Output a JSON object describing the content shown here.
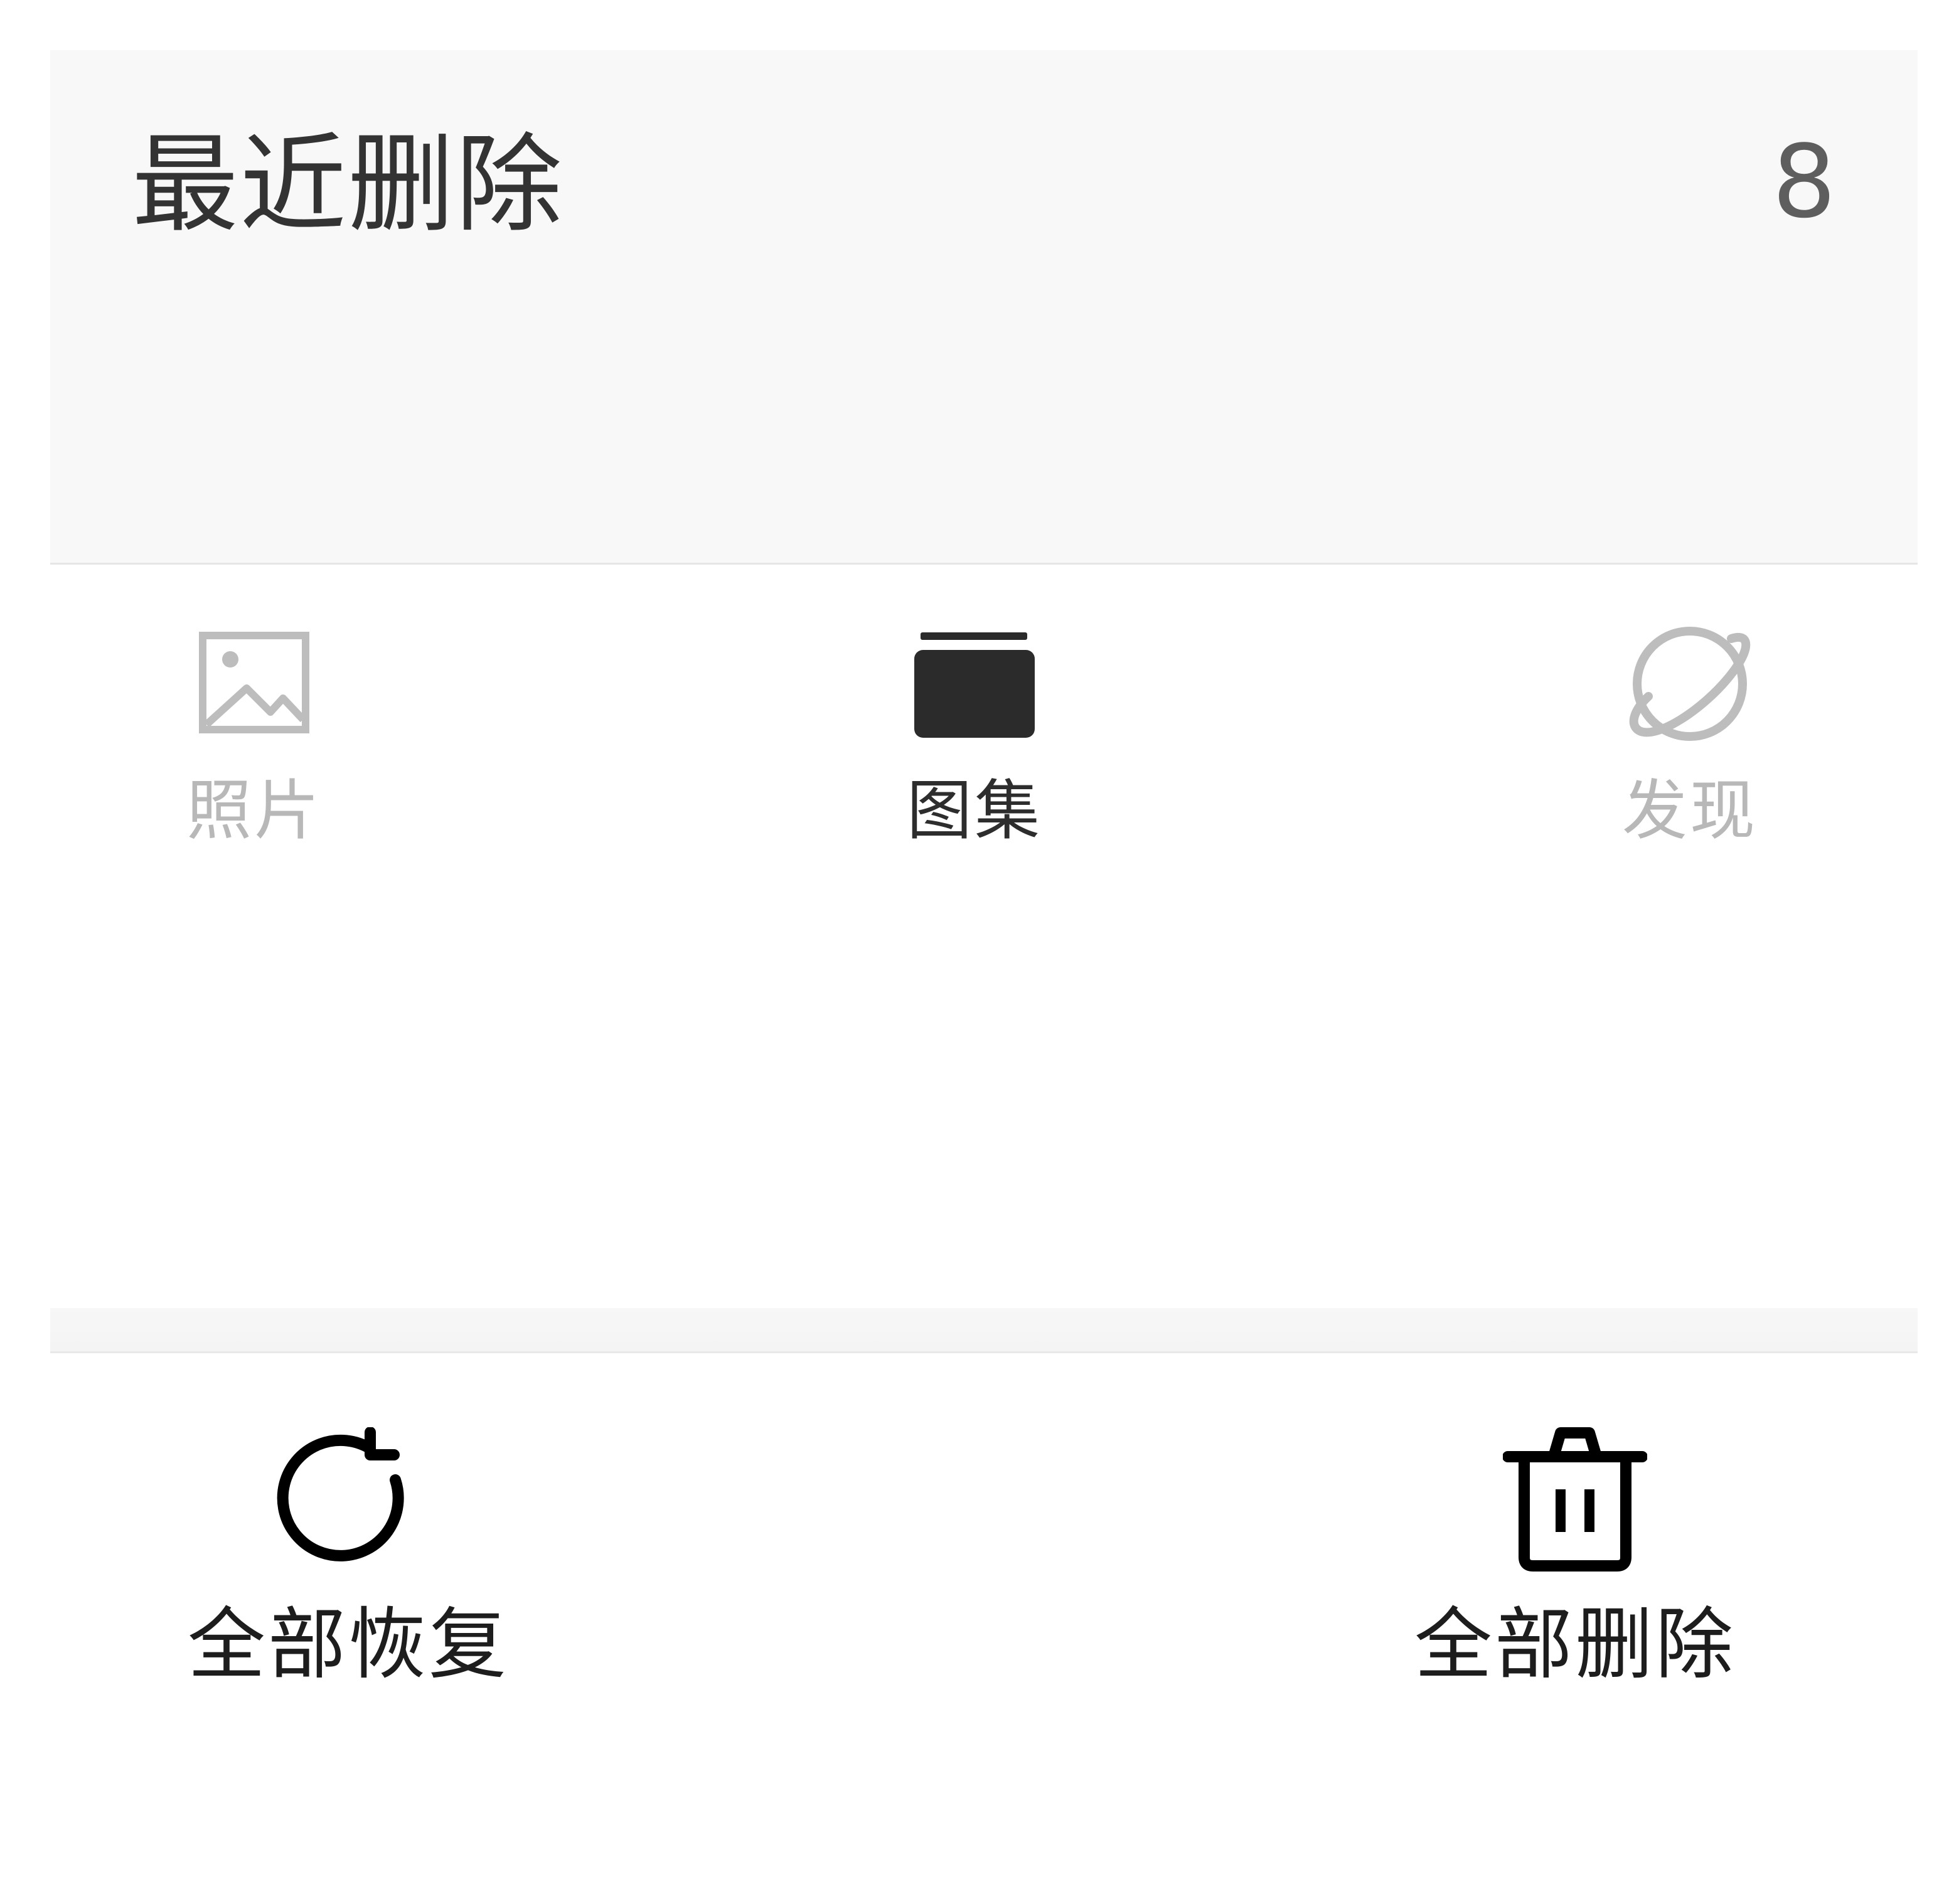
{
  "header": {
    "title": "最近删除",
    "count": "8"
  },
  "tabs": [
    {
      "label": "照片",
      "icon": "image-icon",
      "active": false
    },
    {
      "label": "图集",
      "icon": "album-stack-icon",
      "active": true
    },
    {
      "label": "发现",
      "icon": "planet-icon",
      "active": false
    }
  ],
  "toolbar": {
    "restore_label": "全部恢复",
    "restore_icon": "refresh-icon",
    "delete_label": "全部删除",
    "delete_icon": "trash-icon"
  },
  "colors": {
    "header_bg": "#f8f8f8",
    "active": "#2d2d2d",
    "inactive": "#b8b8b8"
  }
}
